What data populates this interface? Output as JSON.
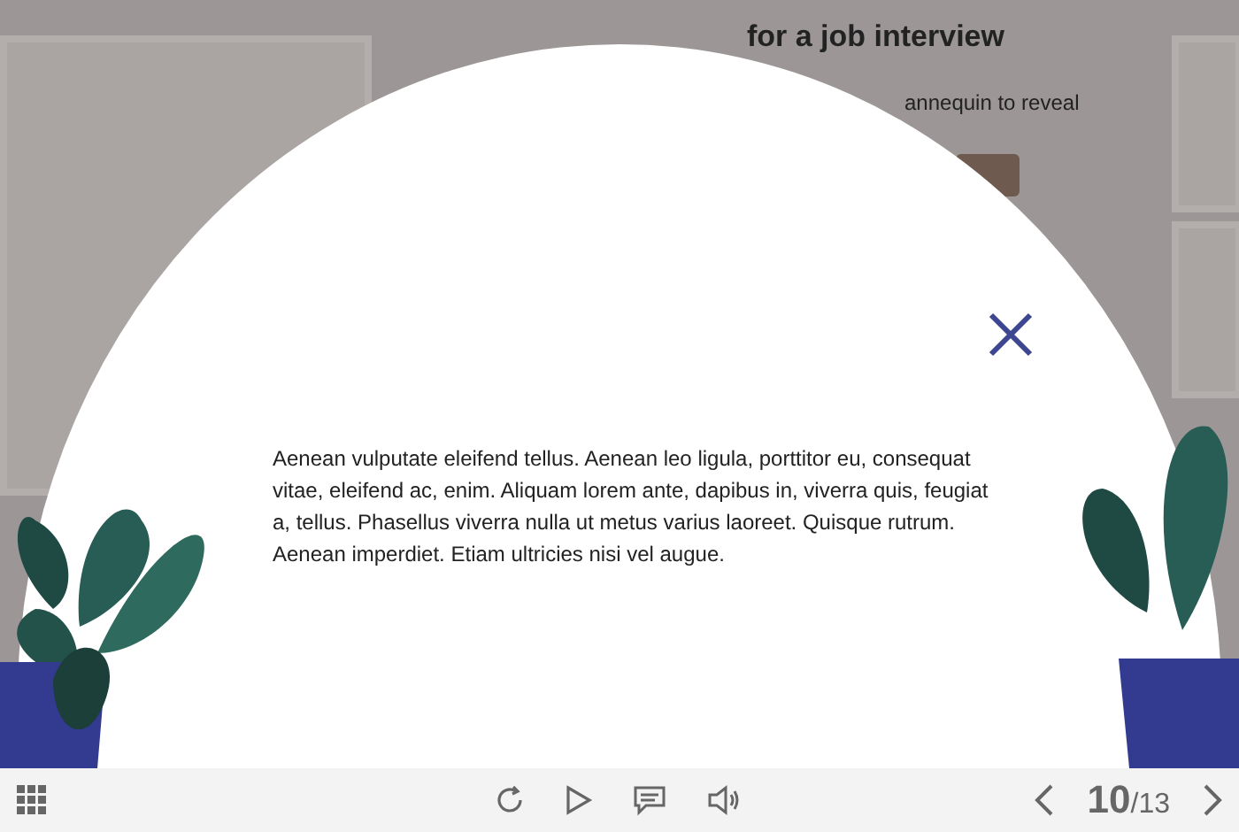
{
  "slide": {
    "title": "for a job interview",
    "instruction": "annequin to reveal"
  },
  "popup": {
    "text": "Aenean vulputate eleifend tellus. Aenean leo ligula, porttitor eu, consequat vitae, eleifend ac, enim. Aliquam lorem ante, dapibus in, viverra quis, feugiat a, tellus. Phasellus viverra nulla ut metus varius laoreet. Quisque rutrum. Aenean imperdiet. Etiam ultricies nisi vel augue."
  },
  "toolbar": {
    "page_current": "10",
    "page_total": "/13"
  }
}
